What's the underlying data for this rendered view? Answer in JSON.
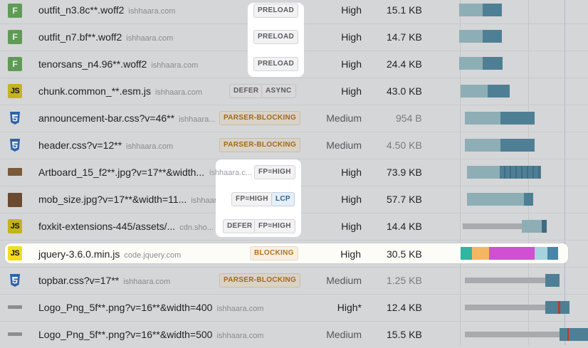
{
  "rows": [
    {
      "icon": "F",
      "name": "outfit_n3.8c**.woff2",
      "domain": "ishhaara.com",
      "badges": [
        "PRELOAD"
      ],
      "priority": "High",
      "size": "15.1 KB"
    },
    {
      "icon": "F",
      "name": "outfit_n7.bf**.woff2",
      "domain": "ishhaara.com",
      "badges": [
        "PRELOAD"
      ],
      "priority": "High",
      "size": "14.7 KB"
    },
    {
      "icon": "F",
      "name": "tenorsans_n4.96**.woff2",
      "domain": "ishhaara.com",
      "badges": [
        "PRELOAD"
      ],
      "priority": "High",
      "size": "24.4 KB"
    },
    {
      "icon": "JS",
      "name": "chunk.common_**.esm.js",
      "domain": "ishhaara.com",
      "badges": [
        "DEFER",
        "ASYNC"
      ],
      "priority": "High",
      "size": "43.0 KB"
    },
    {
      "icon": "css",
      "name": "announcement-bar.css?v=46**",
      "domain": "ishhaara...",
      "badges": [
        "PARSER-BLOCKING"
      ],
      "priority": "Medium",
      "size": "954 B"
    },
    {
      "icon": "css",
      "name": "header.css?v=12**",
      "domain": "ishhaara.com",
      "badges": [
        "PARSER-BLOCKING"
      ],
      "priority": "Medium",
      "size": "4.50 KB"
    },
    {
      "icon": "img",
      "name": "Artboard_15_f2**.jpg?v=17**&width...",
      "domain": "ishhaara.c...",
      "badges": [
        "FP=HIGH"
      ],
      "priority": "High",
      "size": "73.9 KB"
    },
    {
      "icon": "img",
      "name": "mob_size.jpg?v=17**&width=11...",
      "domain": "ishhaara.com",
      "badges": [
        "FP=HIGH",
        "LCP"
      ],
      "priority": "High",
      "size": "57.7 KB"
    },
    {
      "icon": "JS",
      "name": "foxkit-extensions-445/assets/...",
      "domain": "cdn.sho...",
      "badges": [
        "DEFER",
        "FP=HIGH"
      ],
      "priority": "High",
      "size": "14.4 KB"
    },
    {
      "icon": "JS",
      "name": "jquery-3.6.0.min.js",
      "domain": "code.jquery.com",
      "badges": [
        "BLOCKING"
      ],
      "priority": "High",
      "size": "30.5 KB"
    },
    {
      "icon": "css",
      "name": "topbar.css?v=17**",
      "domain": "ishhaara.com",
      "badges": [
        "PARSER-BLOCKING"
      ],
      "priority": "Medium",
      "size": "1.25 KB"
    },
    {
      "icon": "img",
      "name": "Logo_Png_5f**.png?v=16**&width=400",
      "domain": "ishhaara.com",
      "badges": [],
      "priority": "High*",
      "size": "12.4 KB"
    },
    {
      "icon": "img",
      "name": "Logo_Png_5f**.png?v=16**&width=500",
      "domain": "ishhaara.com",
      "badges": [],
      "priority": "Medium",
      "size": "15.5 KB"
    }
  ],
  "colors": {
    "request_wait": "#9bb6bd",
    "request_download": "#4f7f94",
    "blocking_dns": "#2fb5a0",
    "blocking_connect": "#f2b760",
    "blocking_ssl": "#d04fd2",
    "blocking_wait": "#a4d2dd",
    "blocking_download": "#4a86a8",
    "queued": "#a9aaad",
    "marker": "#c0392b"
  }
}
